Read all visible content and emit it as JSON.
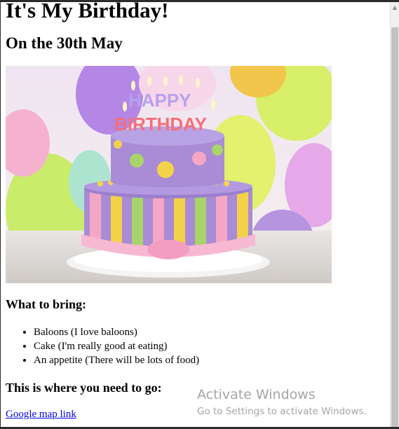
{
  "page": {
    "heading": "It's My Birthday!",
    "subheading": "On the 30th May",
    "image_alt": "Birthday cake with HAPPY BIRTHDAY candles and colorful balloons",
    "bring_heading": "What to bring:",
    "bring_items": [
      "Baloons (I love baloons)",
      "Cake (I'm really good at eating)",
      "An appetite (There will be lots of food)"
    ],
    "where_heading": "This is where you need to go:",
    "map_link": "Google map link"
  },
  "overlay": {
    "activate_title": "Activate Windows",
    "activate_subtitle": "Go to Settings to activate Windows."
  },
  "cake_candles": {
    "line1": "HAPPY",
    "line2": "BIRTHDAY"
  },
  "colors": {
    "link": "#0000ee",
    "cake_purple": "#a98bd6",
    "cake_pink": "#f4a7c4",
    "cake_yellow": "#f3d24a",
    "cake_green": "#a9d36b"
  }
}
